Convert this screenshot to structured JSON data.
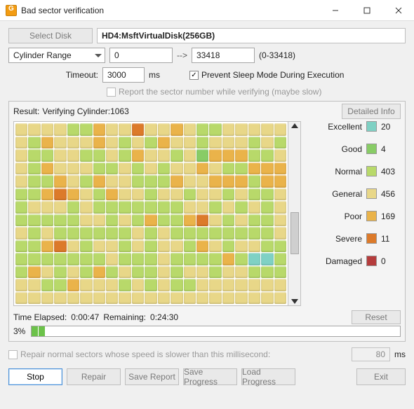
{
  "window": {
    "title": "Bad sector verification"
  },
  "toolbar": {
    "select_disk": "Select Disk",
    "disk": "HD4:MsftVirtualDisk(256GB)",
    "range_mode": "Cylinder Range",
    "range_from": "0",
    "range_arrow": "-->",
    "range_to": "33418",
    "range_hint": "(0-33418)",
    "timeout_lbl": "Timeout:",
    "timeout_val": "3000",
    "timeout_unit": "ms",
    "prevent_sleep": "Prevent Sleep Mode During Execution",
    "report_sector": "Report the sector number while verifying (maybe slow)"
  },
  "result": {
    "prefix": "Result:",
    "status": "Verifying Cylinder:1063",
    "detailed": "Detailed Info"
  },
  "legend": {
    "items": [
      {
        "name": "Excellent",
        "cls": "c-ex",
        "count": "20"
      },
      {
        "name": "Good",
        "cls": "c-go",
        "count": "4"
      },
      {
        "name": "Normal",
        "cls": "c-no",
        "count": "403"
      },
      {
        "name": "General",
        "cls": "c-ge",
        "count": "456"
      },
      {
        "name": "Poor",
        "cls": "c-po",
        "count": "169"
      },
      {
        "name": "Severe",
        "cls": "c-se",
        "count": "11"
      },
      {
        "name": "Damaged",
        "cls": "c-da",
        "count": "0"
      }
    ]
  },
  "time": {
    "elapsed_lbl": "Time Elapsed:",
    "elapsed_val": "0:00:47",
    "remain_lbl": "Remaining:",
    "remain_val": "0:24:30",
    "reset": "Reset",
    "percent": "3%"
  },
  "repair_opt": {
    "label": "Repair normal sectors whose speed is slower than this millisecond:",
    "val": "80",
    "unit": "ms"
  },
  "buttons": {
    "stop": "Stop",
    "repair": "Repair",
    "save_report": "Save Report",
    "save_progress": "Save Progress",
    "load_progress": "Load Progress",
    "exit": "Exit"
  },
  "grid_seed": [
    "gegegegenonopogegesegegepogenonogegege",
    "gegegenopogegegepogenogenopogegenogege",
    "genogenogenonogegenonogenopogegenogego",
    "popopononogegenopogegegenonogenogenoge",
    "gepogenonopopopogenonopogenopogegenono",
    "nopogegepopoponopopononoposepogenopoge",
    "genogegenogegenogenonogenogegegenogeno",
    "nonononononogegenogenogenogenonononono",
    "gegenogenopononoposegenogenonogegenoge",
    "nonononononogenogenonononononononogeno",
    "noposegenogegenogenogegenopogenogegeno",
    "nonononononononogenononogenonononopono",
    "exexnonopogenogenoponogenonogenogegeno",
    "gegenononogegenonopogegegenogenogenono"
  ]
}
